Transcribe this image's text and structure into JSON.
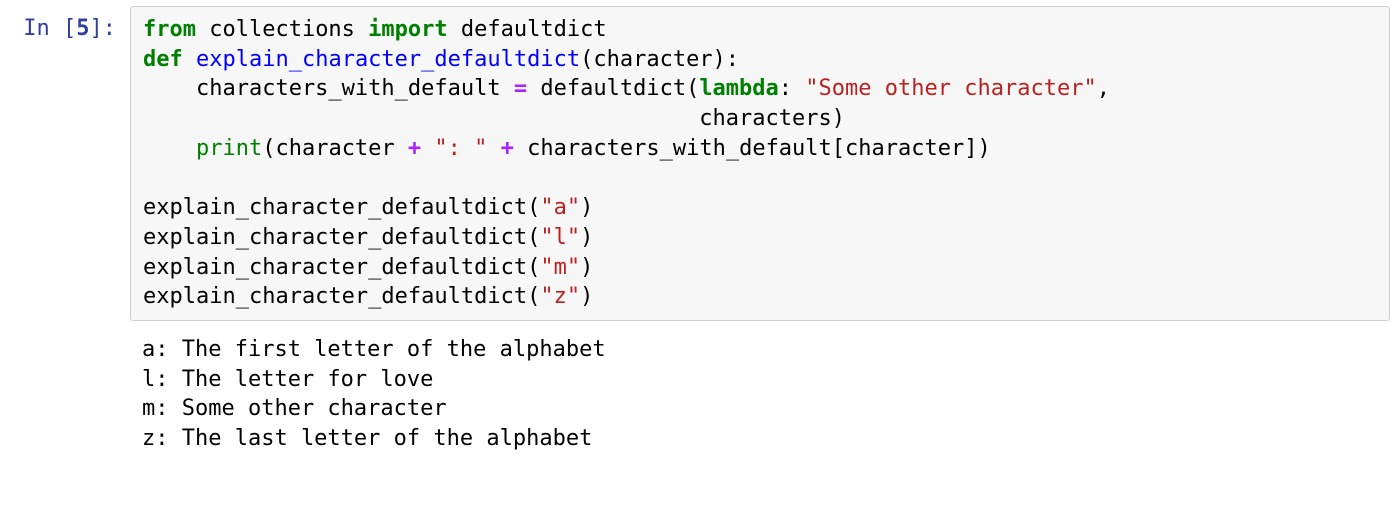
{
  "prompt": {
    "prefix": "In [",
    "number": "5",
    "suffix": "]:"
  },
  "code": {
    "tokens": [
      [
        [
          "kn",
          "from"
        ],
        [
          "n",
          " collections "
        ],
        [
          "kn",
          "import"
        ],
        [
          "n",
          " defaultdict"
        ]
      ],
      [
        [
          "k",
          "def"
        ],
        [
          "n",
          " "
        ],
        [
          "nf",
          "explain_character_defaultdict"
        ],
        [
          "p",
          "(character):"
        ]
      ],
      [
        [
          "n",
          "    characters_with_default "
        ],
        [
          "o",
          "="
        ],
        [
          "n",
          " defaultdict("
        ],
        [
          "k",
          "lambda"
        ],
        [
          "p",
          ": "
        ],
        [
          "s",
          "\"Some other character\""
        ],
        [
          "p",
          ","
        ]
      ],
      [
        [
          "n",
          "                                          characters)"
        ]
      ],
      [
        [
          "n",
          "    "
        ],
        [
          "bi",
          "print"
        ],
        [
          "p",
          "(character "
        ],
        [
          "o",
          "+"
        ],
        [
          "p",
          " "
        ],
        [
          "s",
          "\": \""
        ],
        [
          "p",
          " "
        ],
        [
          "o",
          "+"
        ],
        [
          "p",
          " characters_with_default[character])"
        ]
      ],
      [],
      [
        [
          "n",
          "explain_character_defaultdict("
        ],
        [
          "s",
          "\"a\""
        ],
        [
          "p",
          ")"
        ]
      ],
      [
        [
          "n",
          "explain_character_defaultdict("
        ],
        [
          "s",
          "\"l\""
        ],
        [
          "p",
          ")"
        ]
      ],
      [
        [
          "n",
          "explain_character_defaultdict("
        ],
        [
          "s",
          "\"m\""
        ],
        [
          "p",
          ")"
        ]
      ],
      [
        [
          "n",
          "explain_character_defaultdict("
        ],
        [
          "s",
          "\"z\""
        ],
        [
          "p",
          ")"
        ]
      ]
    ]
  },
  "output": {
    "lines": [
      "a: The first letter of the alphabet",
      "l: The letter for love",
      "m: Some other character",
      "z: The last letter of the alphabet"
    ]
  }
}
